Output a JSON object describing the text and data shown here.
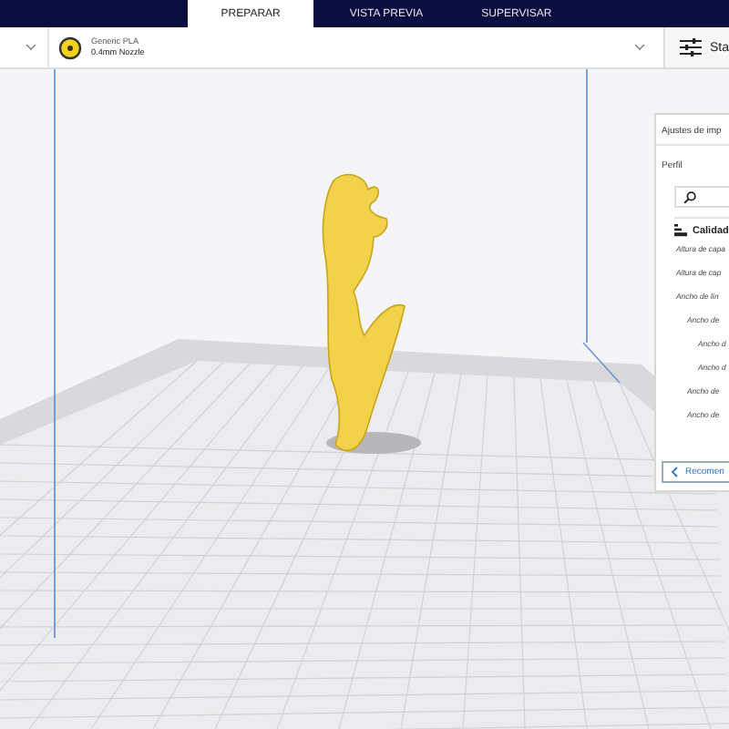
{
  "tabs": [
    {
      "label": "PREPARAR",
      "selected": true
    },
    {
      "label": "VISTA PREVIA",
      "selected": false
    },
    {
      "label": "SUPERVISAR",
      "selected": false
    }
  ],
  "material": {
    "name": "Generic PLA",
    "nozzle": "0.4mm Nozzle"
  },
  "settings_button": {
    "label": "Sta"
  },
  "print_settings": {
    "title": "Ajustes de imp",
    "profile_label": "Perfil",
    "category": "Calidad",
    "settings": [
      {
        "label": "Altura de capa"
      },
      {
        "label": "Altura de cap"
      },
      {
        "label": "Ancho de lín",
        "children": [
          {
            "label": "Ancho de",
            "children": [
              {
                "label": "Ancho d"
              },
              {
                "label": "Ancho d"
              }
            ]
          },
          {
            "label": "Ancho de"
          },
          {
            "label": "Ancho de"
          }
        ]
      }
    ],
    "recommended_button": "Recomen"
  }
}
